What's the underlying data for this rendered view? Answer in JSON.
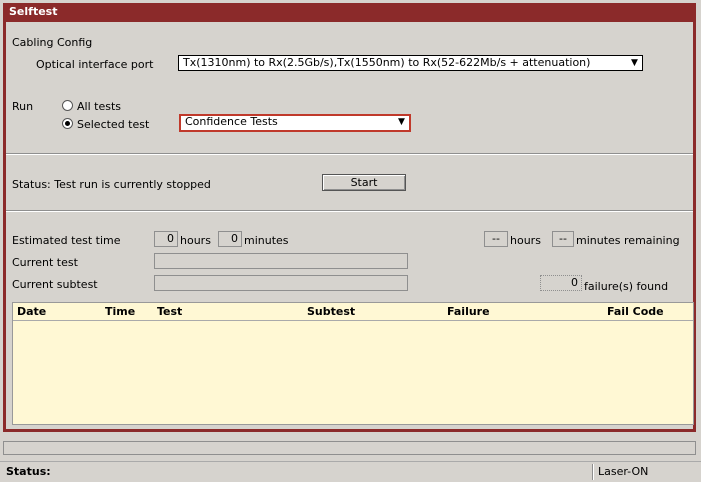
{
  "window": {
    "title": "Selftest"
  },
  "cabling": {
    "section_label": "Cabling Config",
    "port_label": "Optical interface port",
    "port_value": "Tx(1310nm) to Rx(2.5Gb/s),Tx(1550nm) to Rx(52-622Mb/s + attenuation)"
  },
  "run": {
    "label": "Run",
    "all_tests_label": "All tests",
    "selected_test_label": "Selected test",
    "selected_option": "selected",
    "selected_test_value": "Confidence Tests"
  },
  "status": {
    "label": "Status:",
    "text": "Test run is currently stopped",
    "start_button": "Start"
  },
  "progress": {
    "estimated_label": "Estimated test time",
    "est_hours": "0",
    "hours_label": "hours",
    "est_minutes": "0",
    "minutes_label": "minutes",
    "rem_hours": "--",
    "rem_hours_label": "hours",
    "rem_minutes": "--",
    "rem_minutes_label": "minutes remaining",
    "current_test_label": "Current test",
    "current_test_value": "",
    "current_subtest_label": "Current subtest",
    "current_subtest_value": "",
    "failures_count": "0",
    "failures_label": "failure(s) found"
  },
  "results_table": {
    "columns": [
      "Date",
      "Time",
      "Test",
      "Subtest",
      "Failure",
      "Fail Code"
    ],
    "rows": []
  },
  "statusbar": {
    "label": "Status:",
    "laser": "Laser-ON"
  }
}
